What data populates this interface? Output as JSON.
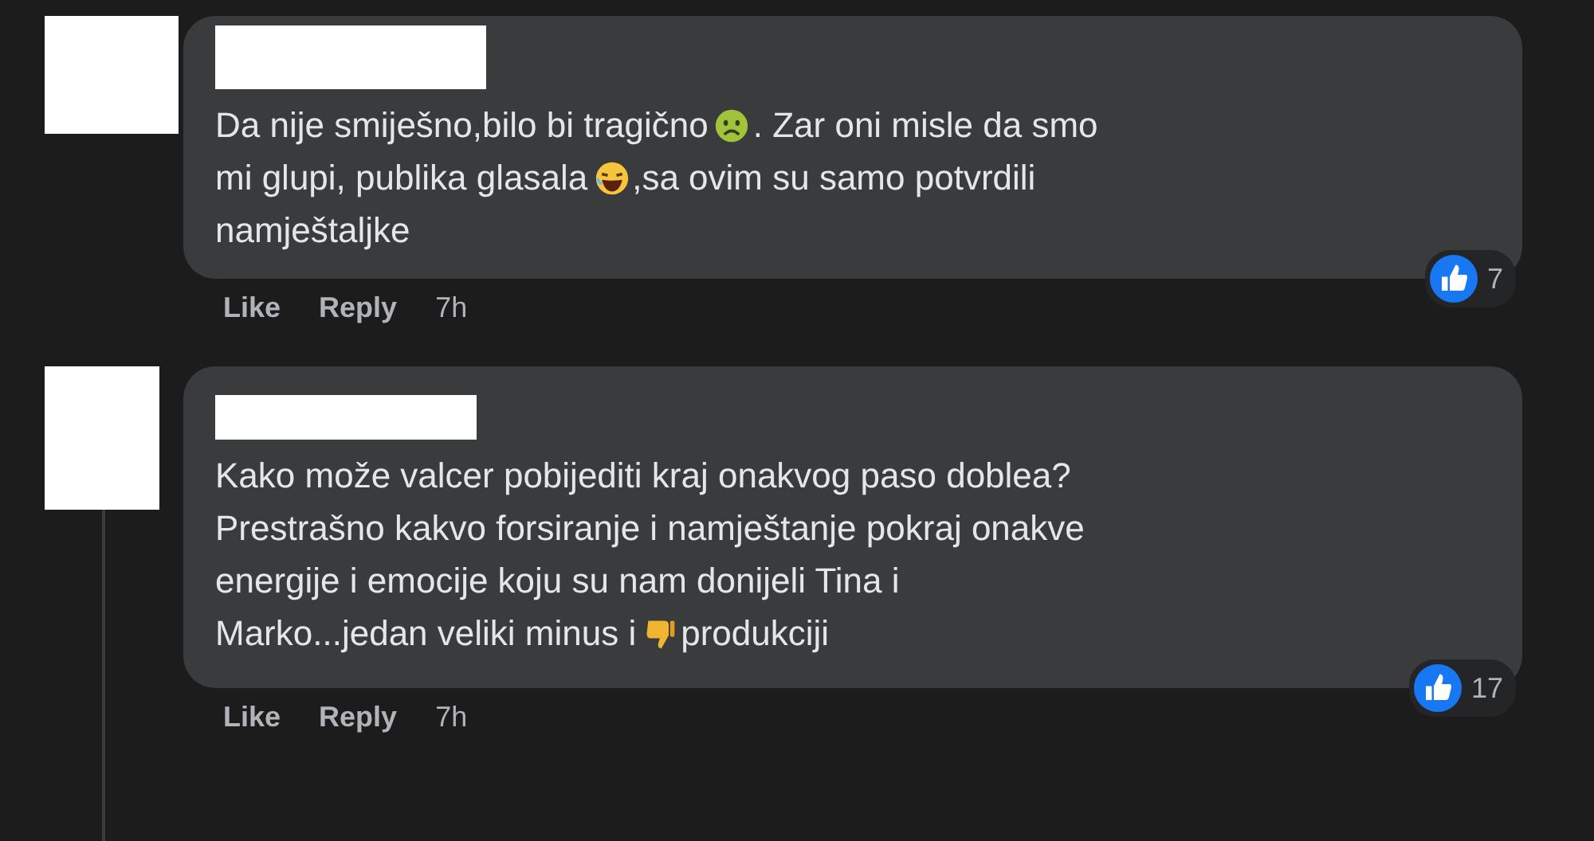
{
  "comments": [
    {
      "lines": [
        [
          {
            "kind": "text",
            "text": "Da nije smiješno,bilo bi tragično"
          },
          {
            "kind": "sick-face"
          },
          {
            "kind": "text",
            "text": ". Zar oni misle da smo"
          }
        ],
        [
          {
            "kind": "text",
            "text": "mi glupi, publika glasala"
          },
          {
            "kind": "laughing-face"
          },
          {
            "kind": "text",
            "text": ",sa ovim su samo potvrdili"
          }
        ],
        [
          {
            "kind": "text",
            "text": "namještaljke"
          }
        ]
      ],
      "actions": [
        "Like",
        "Reply"
      ],
      "time": "7h",
      "reactions": "7"
    },
    {
      "lines": [
        [
          {
            "kind": "text",
            "text": "Kako može valcer pobijediti kraj onakvog paso doblea?"
          }
        ],
        [
          {
            "kind": "text",
            "text": "Prestrašno kakvo forsiranje i namještanje pokraj onakve"
          }
        ],
        [
          {
            "kind": "text",
            "text": "energije i emocije koju su nam donijeli Tina i"
          }
        ],
        [
          {
            "kind": "text",
            "text": "Marko...jedan veliki minus i"
          },
          {
            "kind": "thumbs-down"
          },
          {
            "kind": "text",
            "text": "produkciji"
          }
        ]
      ],
      "actions": [
        "Like",
        "Reply"
      ],
      "time": "7h",
      "reactions": "17"
    }
  ]
}
